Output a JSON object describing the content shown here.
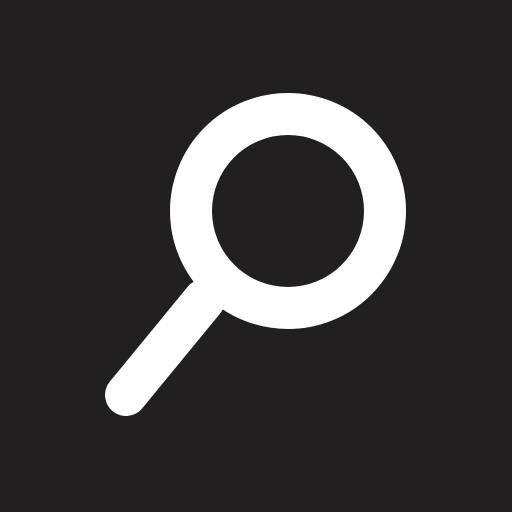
{
  "icon": {
    "name": "search-icon"
  },
  "colors": {
    "background": "#221f20",
    "foreground": "#ffffff"
  }
}
